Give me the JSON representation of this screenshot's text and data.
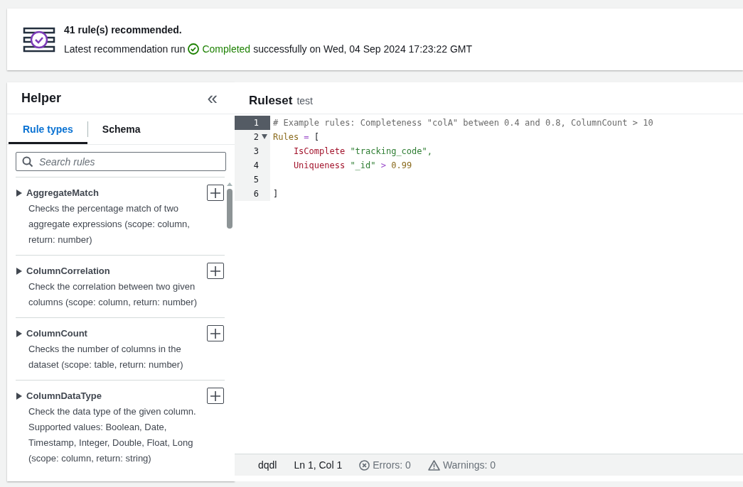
{
  "banner": {
    "title": "41 rule(s) recommended.",
    "prefix": "Latest recommendation run",
    "status": "Completed",
    "suffix": "successfully on Wed, 04 Sep 2024 17:23:22 GMT"
  },
  "helper": {
    "title": "Helper",
    "collapse": "«",
    "tabs": [
      {
        "label": "Rule types",
        "selected": true
      },
      {
        "label": "Schema",
        "selected": false
      }
    ],
    "search": {
      "placeholder": "Search rules"
    },
    "rules": [
      {
        "name": "AggregateMatch",
        "description": "Checks the percentage match of two aggregate expressions (scope: column, return: number)",
        "expanded": false
      },
      {
        "name": "ColumnCorrelation",
        "description": "Check the correlation between two given columns (scope: column, return: number)",
        "expanded": false
      },
      {
        "name": "ColumnCount",
        "description": "Checks the number of columns in the dataset (scope: table, return: number)",
        "expanded": false
      },
      {
        "name": "ColumnDataType",
        "description": "Check the data type of the given column. Supported values: Boolean, Date, Timestamp, Integer, Double, Float, Long (scope: column, return: string)",
        "expanded": false
      }
    ]
  },
  "editor": {
    "title": "Ruleset",
    "subtitle": "test",
    "lines": [
      {
        "number": "1",
        "selected": true,
        "tokens": [
          {
            "kind": "comment",
            "text": "# Example rules: Completeness \"colA\" between 0.4 and 0.8, ColumnCount > 10"
          }
        ]
      },
      {
        "number": "2",
        "selected": false,
        "expanded": true,
        "tokens": [
          {
            "kind": "keyword",
            "text": "Rules"
          },
          {
            "kind": "operator",
            "text": "="
          },
          {
            "kind": "plain",
            "text": "["
          }
        ]
      },
      {
        "number": "3",
        "selected": false,
        "indent": true,
        "tokens": [
          {
            "kind": "rule",
            "text": "IsComplete"
          },
          {
            "kind": "string",
            "text": "\"tracking_code\","
          }
        ]
      },
      {
        "number": "4",
        "selected": false,
        "indent": true,
        "tokens": [
          {
            "kind": "rule",
            "text": "Uniqueness"
          },
          {
            "kind": "string",
            "text": "\"_id\""
          },
          {
            "kind": "operator",
            "text": ">"
          },
          {
            "kind": "number",
            "text": "0.99"
          }
        ]
      },
      {
        "number": "5",
        "selected": false
      },
      {
        "number": "6",
        "selected": false,
        "tokens": [
          {
            "kind": "plain",
            "text": "]"
          }
        ]
      }
    ],
    "status_bar": {
      "language": "dqdl",
      "position": "Ln 1, Col 1",
      "errors": "Errors: 0",
      "warnings": "Warnings: 0"
    }
  }
}
